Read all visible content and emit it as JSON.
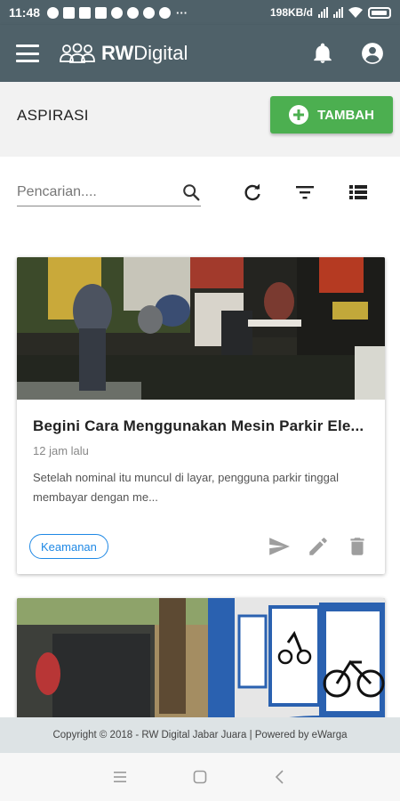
{
  "status_bar": {
    "time": "11:48",
    "network_speed": "198KB/d",
    "more_indicator": "···"
  },
  "app_bar": {
    "brand_bold": "RW",
    "brand_rest": "Digital",
    "menu_icon": "menu-icon",
    "notification_icon": "bell-icon",
    "account_icon": "account-circle-icon"
  },
  "section": {
    "title": "ASPIRASI",
    "add_button_label": "TAMBAH"
  },
  "search": {
    "placeholder": "Pencarian...."
  },
  "toolbar": {
    "icons": [
      "refresh-icon",
      "filter-icon",
      "list-view-icon"
    ]
  },
  "posts": [
    {
      "title": "Begini Cara Menggunakan Mesin Parkir Ele...",
      "time": "12 jam lalu",
      "description": "Setelah nominal itu muncul di layar, pengguna parkir tinggal membayar dengan me...",
      "tag": "Keamanan",
      "actions": [
        "send-icon",
        "edit-icon",
        "delete-icon"
      ]
    },
    {
      "title": "",
      "time": "",
      "description": "",
      "tag": ""
    }
  ],
  "footer": {
    "text": "Copyright © 2018 - RW Digital Jabar Juara | Powered by eWarga"
  },
  "colors": {
    "app_bar": "#4f6169",
    "add_button": "#4caf50",
    "tag_chip": "#1e88e5",
    "footer_bg": "#dde3e5"
  }
}
